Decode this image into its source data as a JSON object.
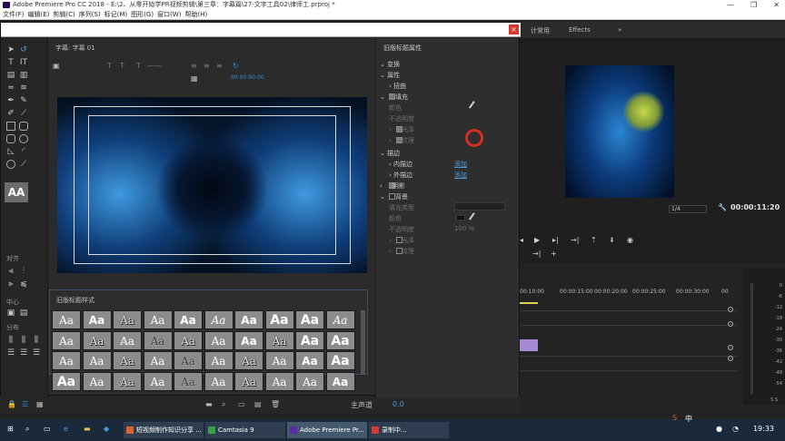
{
  "window": {
    "title": "Adobe Premiere Pro CC 2018 - E:\\2、从零开始学PR视频剪辑\\第三章：字幕篇\\27-文字工具02\\律师工.prproj *",
    "controls": [
      "—",
      "❐",
      "✕"
    ]
  },
  "menu": [
    "文件(F)",
    "编辑(E)",
    "剪辑(C)",
    "序列(S)",
    "标记(M)",
    "图形(G)",
    "窗口(W)",
    "帮助(H)"
  ],
  "titler": {
    "canvas_title": "字幕: 字幕 01",
    "timecode": "00:00:00:00",
    "tools_labels": {
      "align": "对齐",
      "center": "中心",
      "distribute": "分布"
    },
    "styles_title": "旧版标题样式",
    "styles": [
      [
        "Aa",
        "Aa",
        "Aa",
        "Aa",
        "Aa",
        "Aa",
        "Aa",
        "Aa",
        "Aa",
        "Aa"
      ],
      [
        "Aa",
        "Aa",
        "Aa",
        "Aa",
        "Aa",
        "Aa",
        "Aa",
        "Aa",
        "Aa",
        "Aa"
      ],
      [
        "Aa",
        "Aa",
        "Aa",
        "Aa",
        "Aa",
        "Aa",
        "Aa",
        "Aa",
        "Aa",
        "Aa"
      ],
      [
        "Aa",
        "Aa",
        "Aa",
        "Aa",
        "Aa",
        "Aa",
        "Aa",
        "Aa",
        "Aa",
        "Aa"
      ]
    ],
    "properties": {
      "title": "旧版标题属性",
      "transform": "变换",
      "attributes": "属性",
      "distort": "扭曲",
      "fill": "填充",
      "color": "颜色",
      "opacity": "不透明度",
      "sheen": "光泽",
      "texture": "纹理",
      "strokes": "描边",
      "inner_stroke": "内描边",
      "outer_stroke": "外描边",
      "add": "添加",
      "shadow": "阴影",
      "background": "背景",
      "fill_type": "填充类型",
      "bg_color": "颜色",
      "bg_opacity": "不透明度",
      "bg_opacity_value": "100 %",
      "bg_sheen": "光泽",
      "bg_texture": "纹理"
    }
  },
  "panel_tabs": [
    "计常用",
    "Effects",
    "»"
  ],
  "program": {
    "zoom": "1/4",
    "timecode": "00:00:11:20"
  },
  "timeline": {
    "ticks": [
      "00:10:00",
      "00:00:15:00",
      "00:00:20:00",
      "00:00:25:00",
      "00:00:30:00",
      "00"
    ]
  },
  "meter": {
    "labels": [
      "0",
      "-6",
      "-12",
      "-18",
      "-24",
      "-30",
      "-36",
      "-42",
      "-48",
      "-54"
    ],
    "footer": "S S"
  },
  "bottom": {
    "master_label": "主声道",
    "master_value": "0.0"
  },
  "taskbar": {
    "tasks": [
      {
        "label": "短视频制作知识分享 ...",
        "color": "#e0622b"
      },
      {
        "label": "Camtasia 9",
        "color": "#3aa04a"
      },
      {
        "label": "Adobe Premiere Pr...",
        "color": "#5b2ca0"
      },
      {
        "label": "录制中...",
        "color": "#d43a3a"
      }
    ],
    "tray": "中",
    "clock": "19:33"
  }
}
